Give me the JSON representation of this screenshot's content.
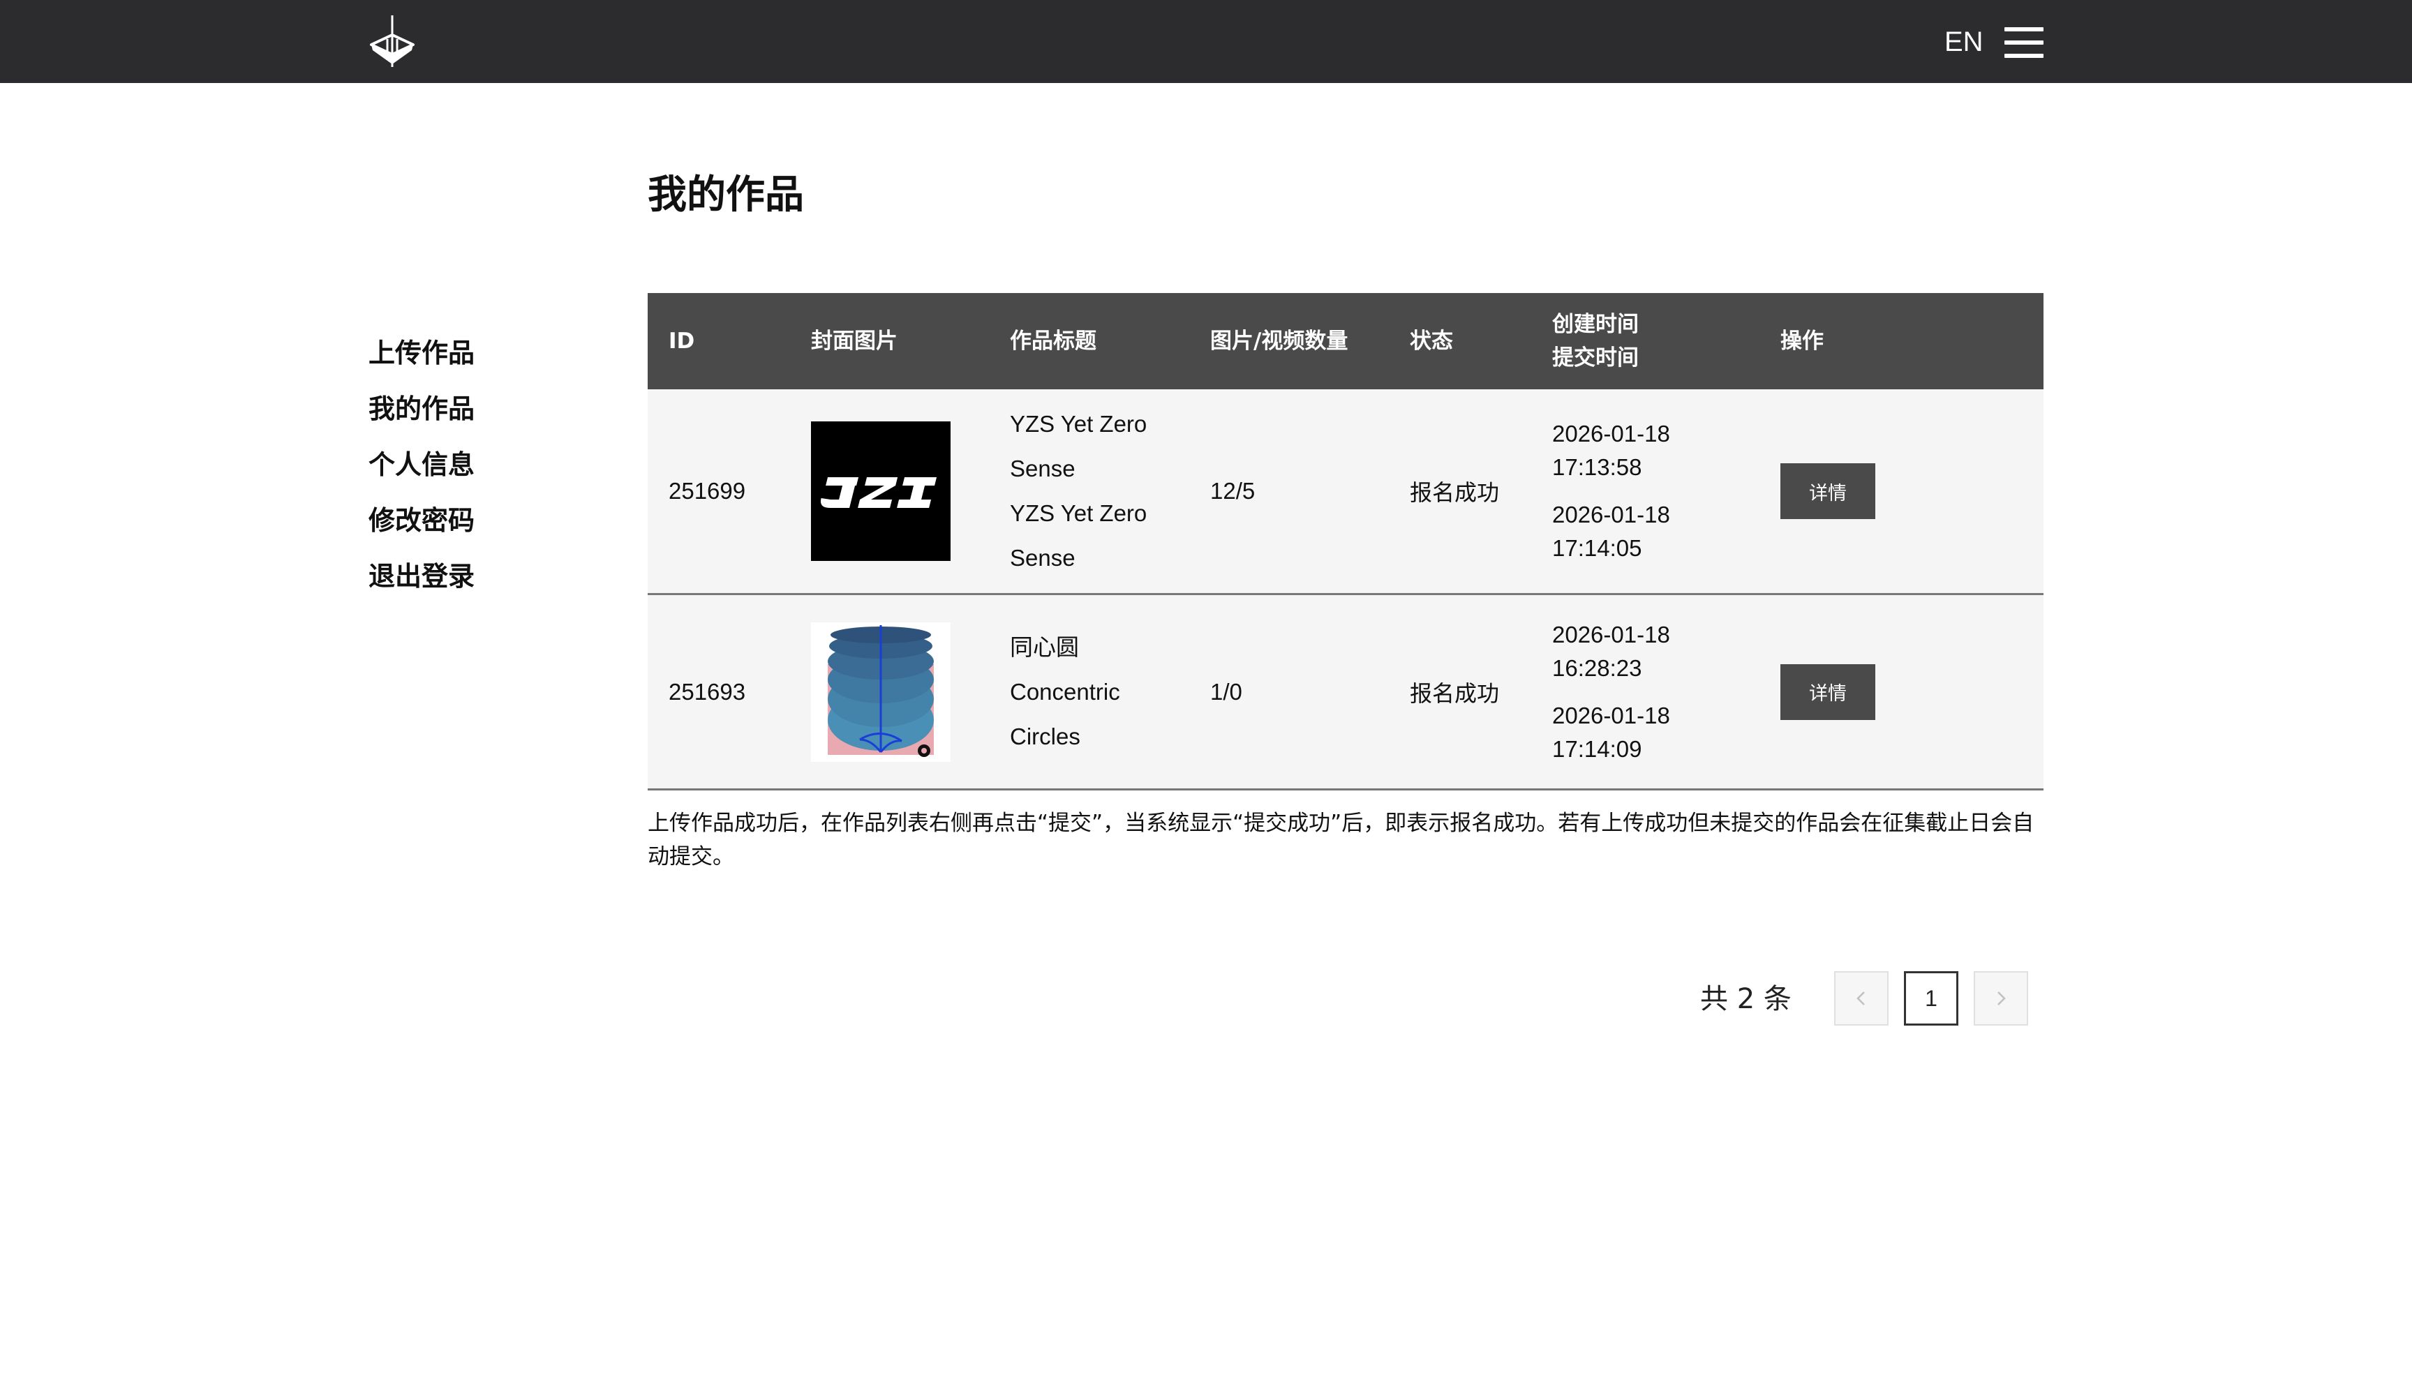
{
  "header": {
    "logo_icon": "brand-logo-icon",
    "lang_label": "EN",
    "menu_icon": "hamburger-menu-icon"
  },
  "sidebar": {
    "items": [
      {
        "label": "上传作品"
      },
      {
        "label": "我的作品"
      },
      {
        "label": "个人信息"
      },
      {
        "label": "修改密码"
      },
      {
        "label": "退出登录"
      }
    ]
  },
  "page_title": "我的作品",
  "table": {
    "columns": {
      "id": "ID",
      "cover": "封面图片",
      "title": "作品标题",
      "count": "图片/视频数量",
      "status": "状态",
      "created": "创建时间",
      "submitted": "提交时间",
      "action": "操作"
    },
    "rows": [
      {
        "id": "251699",
        "title_lines": [
          "YZS Yet Zero",
          "Sense",
          "YZS Yet Zero",
          "Sense"
        ],
        "count": "12/5",
        "status": "报名成功",
        "created_date": "2026-01-18",
        "created_time": "17:13:58",
        "submitted_date": "2026-01-18",
        "submitted_time": "17:14:05",
        "action_label": "详情"
      },
      {
        "id": "251693",
        "title_lines": [
          "同心圆",
          "Concentric",
          "Circles"
        ],
        "count": "1/0",
        "status": "报名成功",
        "created_date": "2026-01-18",
        "created_time": "16:28:23",
        "submitted_date": "2026-01-18",
        "submitted_time": "17:14:09",
        "action_label": "详情"
      }
    ]
  },
  "notice": "上传作品成功后，在作品列表右侧再点击“提交”，当系统显示“提交成功”后，即表示报名成功。若有上传成功但未提交的作品会在征集截止日会自动提交。",
  "pagination": {
    "total_label": "共 2 条",
    "current_page": "1",
    "prev_icon": "chevron-left-icon",
    "next_icon": "chevron-right-icon"
  },
  "colors": {
    "header_bg": "#2c2c2e",
    "table_header_bg": "#4a4a4a",
    "row_bg": "#f5f5f5",
    "button_bg": "#4a4a4a"
  }
}
